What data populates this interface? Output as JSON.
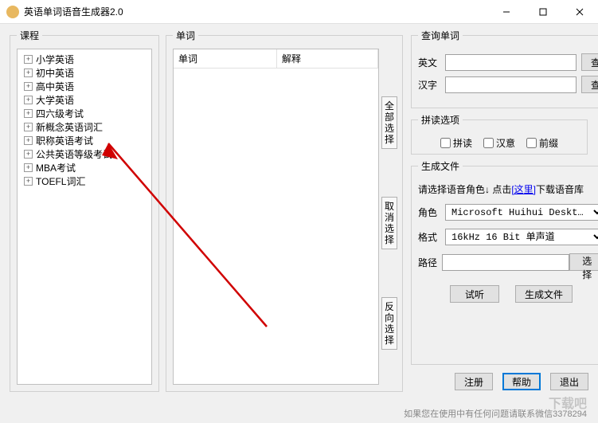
{
  "window": {
    "title": "英语单词语音生成器2.0"
  },
  "groups": {
    "courses": "课程",
    "words": "单词",
    "query": "查询单词",
    "pinyin": "拼读选项",
    "generate": "生成文件"
  },
  "tree": {
    "items": [
      {
        "label": "小学英语"
      },
      {
        "label": "初中英语"
      },
      {
        "label": "高中英语"
      },
      {
        "label": "大学英语"
      },
      {
        "label": "四六级考试"
      },
      {
        "label": "新概念英语词汇"
      },
      {
        "label": "职称英语考试"
      },
      {
        "label": "公共英语等级考试"
      },
      {
        "label": "MBA考试"
      },
      {
        "label": "TOEFL词汇"
      }
    ]
  },
  "listview": {
    "columns": [
      "单词",
      "解释"
    ]
  },
  "sidebuttons": {
    "selectAll": "全部选择",
    "deselect": "取消选择",
    "invert": "反向选择"
  },
  "query": {
    "englishLabel": "英文",
    "chineseLabel": "汉字",
    "englishValue": "",
    "chineseValue": "",
    "searchBtn": "查询"
  },
  "pinyin": {
    "opt1": "拼读",
    "opt2": "汉意",
    "opt3": "前缀"
  },
  "generate": {
    "hintPrefix": "请选择语音角色↓  点击",
    "hintLink": "[这里]",
    "hintSuffix": "下载语音库",
    "roleLabel": "角色",
    "roleValue": "Microsoft Huihui Deskt…",
    "formatLabel": "格式",
    "formatValue": "16kHz 16 Bit 单声道",
    "pathLabel": "路径",
    "pathValue": "",
    "browseBtn": "选择",
    "previewBtn": "试听",
    "generateBtn": "生成文件"
  },
  "bottom": {
    "register": "注册",
    "help": "帮助",
    "exit": "退出"
  },
  "footer": "如果您在使用中有任何问题请联系微信3378294",
  "watermark": "下载吧"
}
